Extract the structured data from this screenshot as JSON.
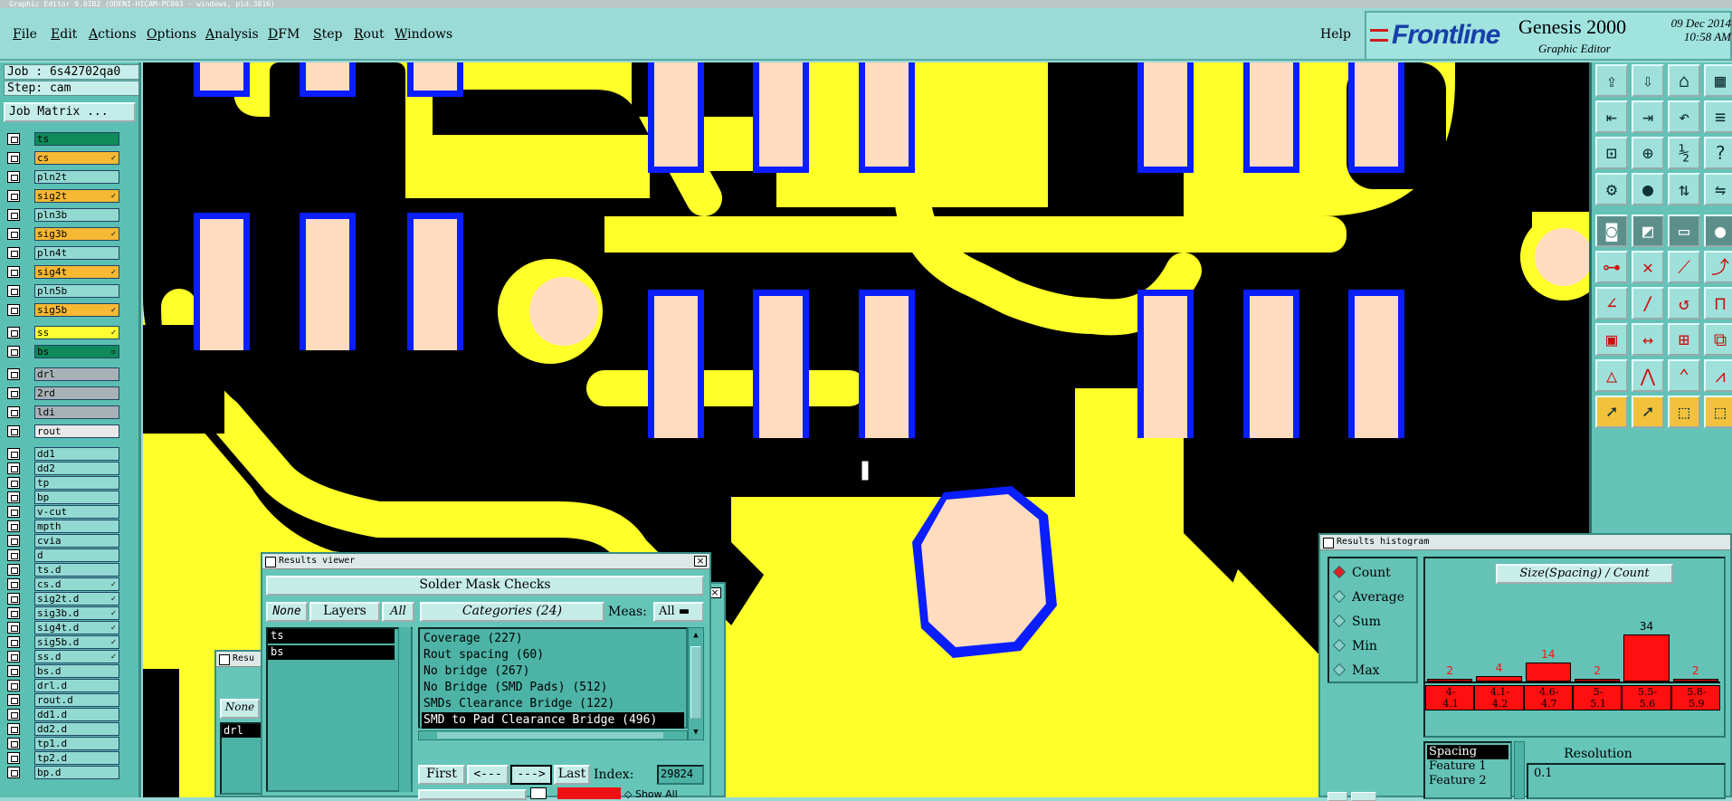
{
  "window_title": "Graphic Editor 9.0IB2 (ODENI-HICAM-PC003 - windows, pid.3816)",
  "menu": [
    "File",
    "Edit",
    "Actions",
    "Options",
    "Analysis",
    "DFM",
    "Step",
    "Rout",
    "Windows"
  ],
  "help": "Help",
  "brand": {
    "logo": "Frontline",
    "product": "Genesis 2000",
    "subtitle": "Graphic Editor",
    "date": "09 Dec 2014",
    "time": "10:58 AM"
  },
  "job_label": "Job : 6s42702qa0",
  "step_label": "Step: cam",
  "job_matrix_button": "Job Matrix ...",
  "colors": {
    "board_copper": "#ffff2a",
    "pad": "#ffdcbf",
    "mask_outline": "#0a1eff",
    "canvas_bg": "#000000",
    "panel": "#5bbfb3",
    "hist_bar": "#ff0f0f"
  },
  "layers": [
    {
      "name": "ts",
      "color": "#0f8a5a",
      "text": "#000",
      "mark": ""
    },
    {
      "name": "cs",
      "color": "#f7b833",
      "text": "#000",
      "mark": "✓"
    },
    {
      "name": "pln2t",
      "color": "#92d9d2",
      "text": "#000",
      "mark": ""
    },
    {
      "name": "sig2t",
      "color": "#f7b833",
      "text": "#000",
      "mark": "✓"
    },
    {
      "name": "pln3b",
      "color": "#92d9d2",
      "text": "#000",
      "mark": ""
    },
    {
      "name": "sig3b",
      "color": "#f7b833",
      "text": "#000",
      "mark": "✓"
    },
    {
      "name": "pln4t",
      "color": "#92d9d2",
      "text": "#000",
      "mark": ""
    },
    {
      "name": "sig4t",
      "color": "#f7b833",
      "text": "#000",
      "mark": "✓"
    },
    {
      "name": "pln5b",
      "color": "#92d9d2",
      "text": "#000",
      "mark": ""
    },
    {
      "name": "sig5b",
      "color": "#f7b833",
      "text": "#000",
      "mark": "✓"
    },
    {
      "name": "ss",
      "color": "#ffff33",
      "text": "#000",
      "mark": "✓"
    },
    {
      "name": "bs",
      "color": "#0f8a5a",
      "text": "#000",
      "mark": "▫"
    },
    {
      "name": "drl",
      "color": "#a8b2b6",
      "text": "#000",
      "mark": ""
    },
    {
      "name": "2rd",
      "color": "#a8b2b6",
      "text": "#000",
      "mark": ""
    },
    {
      "name": "ldi",
      "color": "#a8b2b6",
      "text": "#000",
      "mark": ""
    },
    {
      "name": "rout",
      "color": "#e9e9e9",
      "text": "#000",
      "mark": ""
    },
    {
      "name": "dd1",
      "color": "#92d9d2",
      "text": "#000",
      "mark": ""
    },
    {
      "name": "dd2",
      "color": "#92d9d2",
      "text": "#000",
      "mark": ""
    },
    {
      "name": "tp",
      "color": "#92d9d2",
      "text": "#000",
      "mark": ""
    },
    {
      "name": "bp",
      "color": "#92d9d2",
      "text": "#000",
      "mark": ""
    },
    {
      "name": "v-cut",
      "color": "#92d9d2",
      "text": "#000",
      "mark": ""
    },
    {
      "name": "mpth",
      "color": "#92d9d2",
      "text": "#000",
      "mark": ""
    },
    {
      "name": "cvia",
      "color": "#92d9d2",
      "text": "#000",
      "mark": ""
    },
    {
      "name": "d",
      "color": "#92d9d2",
      "text": "#000",
      "mark": ""
    },
    {
      "name": "ts.d",
      "color": "#92d9d2",
      "text": "#000",
      "mark": ""
    },
    {
      "name": "cs.d",
      "color": "#92d9d2",
      "text": "#000",
      "mark": "✓"
    },
    {
      "name": "sig2t.d",
      "color": "#92d9d2",
      "text": "#000",
      "mark": "✓"
    },
    {
      "name": "sig3b.d",
      "color": "#92d9d2",
      "text": "#000",
      "mark": "✓"
    },
    {
      "name": "sig4t.d",
      "color": "#92d9d2",
      "text": "#000",
      "mark": "✓"
    },
    {
      "name": "sig5b.d",
      "color": "#92d9d2",
      "text": "#000",
      "mark": "✓"
    },
    {
      "name": "ss.d",
      "color": "#92d9d2",
      "text": "#000",
      "mark": "✓"
    },
    {
      "name": "bs.d",
      "color": "#92d9d2",
      "text": "#000",
      "mark": ""
    },
    {
      "name": "drl.d",
      "color": "#92d9d2",
      "text": "#000",
      "mark": ""
    },
    {
      "name": "rout.d",
      "color": "#92d9d2",
      "text": "#000",
      "mark": ""
    },
    {
      "name": "dd1.d",
      "color": "#92d9d2",
      "text": "#000",
      "mark": ""
    },
    {
      "name": "dd2.d",
      "color": "#92d9d2",
      "text": "#000",
      "mark": ""
    },
    {
      "name": "tp1.d",
      "color": "#92d9d2",
      "text": "#000",
      "mark": ""
    },
    {
      "name": "tp2.d",
      "color": "#92d9d2",
      "text": "#000",
      "mark": ""
    },
    {
      "name": "bp.d",
      "color": "#92d9d2",
      "text": "#000",
      "mark": ""
    }
  ],
  "toolbox_icons": [
    [
      "open-icon",
      "save-icon",
      "home-icon",
      "grid-icon"
    ],
    [
      "undo-icon",
      "redo-icon",
      "back-icon",
      "snap-icon"
    ],
    [
      "zoom-fit-icon",
      "zoom-area-icon",
      "scale-icon",
      "query-icon"
    ],
    [
      "measure-icon",
      "probe-icon",
      "net-icon",
      "net-select-icon"
    ],
    [
      "box-icon",
      "cross-select-icon",
      "ruler-icon",
      "dot-icon"
    ],
    [
      "connect-icon",
      "delete-icon",
      "line-icon",
      "curve-icon"
    ],
    [
      "angle-icon",
      "slash-icon",
      "arc-icon",
      "route-icon"
    ],
    [
      "pad-icon",
      "dimension-icon",
      "center-icon",
      "multi-icon"
    ],
    [
      "triangle-icon",
      "spike-icon",
      "peak-icon",
      "mountain-icon"
    ],
    [
      "pointer-icon",
      "select-icon",
      "select-box-icon",
      "select-more-icon"
    ]
  ],
  "results_viewer": {
    "title": "Results viewer",
    "header": "Solder Mask Checks",
    "btn_none": "None",
    "btn_layers": "Layers",
    "btn_all": "All",
    "categories_header": "Categories (24)",
    "meas_label": "Meas:",
    "meas_value": "All",
    "layers": [
      "ts",
      "bs"
    ],
    "categories": [
      "Coverage (227)",
      "Rout spacing (60)",
      "No bridge (267)",
      "No Bridge (SMD Pads) (512)",
      "SMDs Clearance Bridge (122)",
      "SMD to Pad Clearance Bridge (496)"
    ],
    "selected_category": 5,
    "nav_first": "First",
    "nav_prev": "<---",
    "nav_next": "--->",
    "nav_last": "Last",
    "index_label": "Index:",
    "index_value": "29824",
    "show_all": "Show All"
  },
  "results_viewer_back": {
    "title": "Resu",
    "btn_none": "None",
    "item": "drl"
  },
  "histogram": {
    "title": "Results histogram",
    "options": [
      "Count",
      "Average",
      "Sum",
      "Min",
      "Max"
    ],
    "selected": 0,
    "chart_title": "Size(Spacing) / Count",
    "resolution_label": "Resolution",
    "resolution_value": "0.1",
    "list": [
      "Spacing",
      "Feature 1",
      "Feature 2"
    ]
  },
  "chart_data": {
    "type": "bar",
    "title": "Size(Spacing) / Count",
    "categories": [
      "4-4.1",
      "4.1-4.2",
      "4.6-4.7",
      "5-5.1",
      "5.5-5.6",
      "5.8-5.9"
    ],
    "category_labels": [
      [
        "4-",
        "4.1"
      ],
      [
        "4.1-",
        "4.2"
      ],
      [
        "4.6-",
        "4.7"
      ],
      [
        "5-",
        "5.1"
      ],
      [
        "5.5-",
        "5.6"
      ],
      [
        "5.8-",
        "5.9"
      ]
    ],
    "values": [
      2,
      4,
      14,
      2,
      34,
      2
    ],
    "ylim": [
      0,
      34
    ]
  }
}
